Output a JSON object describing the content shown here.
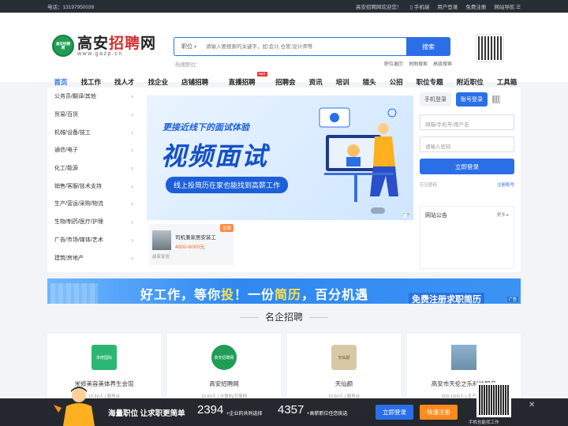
{
  "topbar": {
    "phone": "电话：13197950039",
    "welcome": "高安招聘网欢迎您！",
    "mobile": "手机端",
    "user": "用户登录",
    "register": "免费注册",
    "sitenav": "网站导航"
  },
  "logo": {
    "cn_a": "高安",
    "cn_b": "招聘",
    "cn_c": "网",
    "url": "www.gazp.cn",
    "badge": "高安招聘网"
  },
  "search": {
    "type": "职位",
    "placeholder": "请输入要搜索的关键字，如:会计,仓管,设计师等",
    "button": "搜索",
    "hot": "热搜职位：",
    "quick": [
      "职位遍历",
      "地图搜索",
      "高级搜索"
    ]
  },
  "nav": {
    "items": [
      "首页",
      "找工作",
      "找人才",
      "找企业",
      "店铺招聘",
      "直播招聘",
      "招聘会",
      "资讯",
      "培训",
      "猎头",
      "公招",
      "职位专题",
      "附近职位",
      "工具箱"
    ],
    "hot_badge": "HOT"
  },
  "categories": [
    "公务员/翻译/其他",
    "贸易/百货",
    "机械/设备/技工",
    "通信/电子",
    "化工/能源",
    "销售/客服/技术支持",
    "生产/营运/采购/物流",
    "生物/制药/医疗/护理",
    "广告/市场/媒体/艺术",
    "建筑/房地产"
  ],
  "banner": {
    "line1": "更接近线下的面试体验",
    "line2": "视频面试",
    "line3": "线上投简历在家也能找到高薪工作",
    "ad": "广告"
  },
  "job_card": {
    "tag": "急聘",
    "name": "司机兼家居安装工",
    "salary": "4000-6000元",
    "company": "晨家家居"
  },
  "login": {
    "tab1": "手机登录",
    "tab2": "账号登录",
    "user_placeholder": "邮箱/手机号/用户名",
    "pwd_placeholder": "请输入密码",
    "button": "立即登录",
    "forgot": "忘记密码",
    "register": "注册账号"
  },
  "notice": {
    "title": "网站公告",
    "more": "更多"
  },
  "strip": {
    "a": "好工作，等你",
    "b": "投",
    "c": "！一份",
    "d": "简历",
    "e": "，百分机遇",
    "reg": "免费注册求职简历",
    "ad": "广告"
  },
  "section": {
    "title": "名企招聘"
  },
  "companies": [
    {
      "name": "米修美容美体养生会馆",
      "meta": "10-50人 | 服务业",
      "logo": "米修国际",
      "color": "#2bb673"
    },
    {
      "name": "高安招聘网",
      "meta": "10-50人 | 计算机/互联网",
      "logo": "高安招聘网",
      "color": "#1f9d55"
    },
    {
      "name": "天仙颜",
      "meta": "10-50人 | 服务业",
      "logo": "天仙颜",
      "color": "#d7c9a6"
    },
    {
      "name": "高安市天伦之乐科技服务",
      "meta": "500-1000人 | 生产/制造",
      "logo": "",
      "color": "#6c8fa8"
    }
  ],
  "bottom": {
    "slogan": "海量职位 让求职更简单",
    "num1": "2394",
    "lab1": "+企业的共同选择",
    "num2": "4357",
    "lab2": "+高薪职位任您挑选",
    "btn1": "立即登录",
    "btn2": "快速注册",
    "qr_label": "手机也能找工作",
    "close": "✕"
  }
}
